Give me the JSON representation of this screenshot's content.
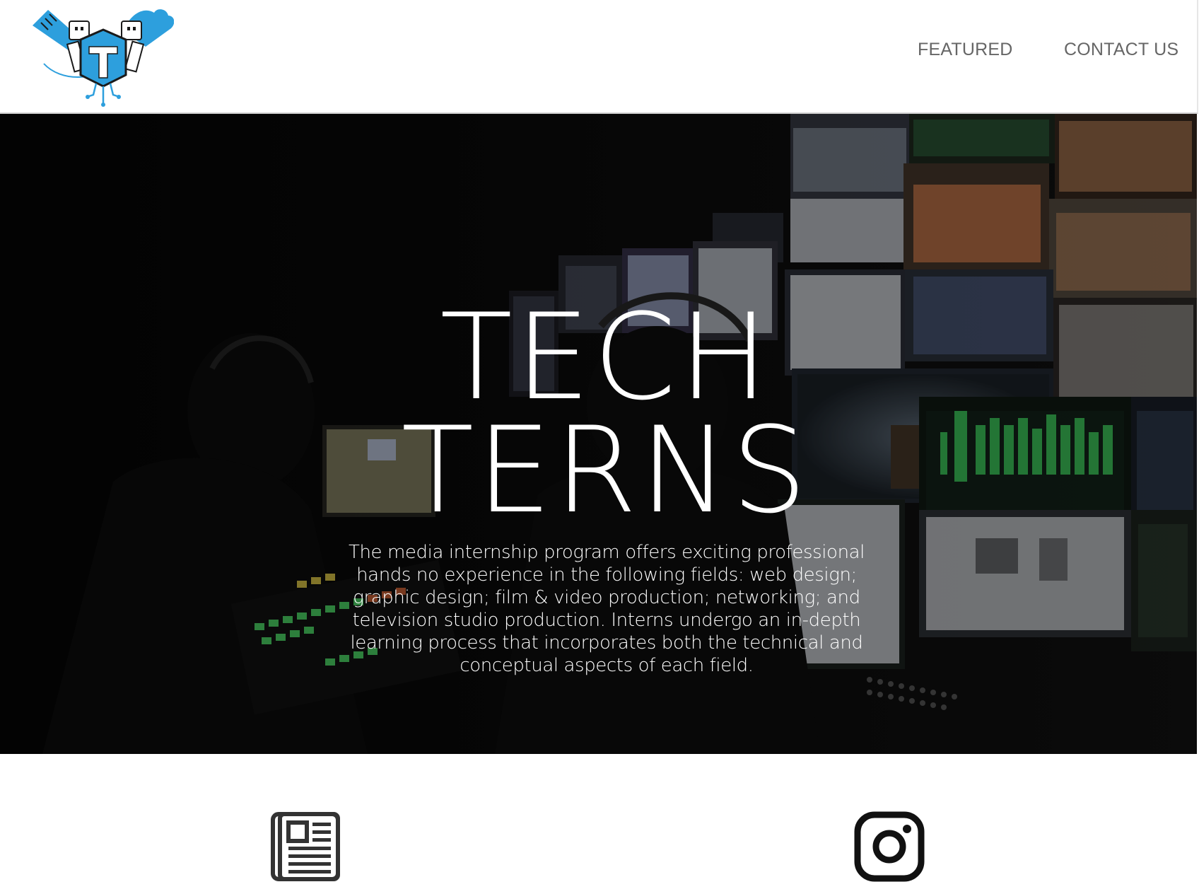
{
  "nav": {
    "featured_label": "FEATURED",
    "contact_label": "CONTACT US"
  },
  "hero": {
    "title_line1": "TECH",
    "title_line2": "TERNS",
    "description": "The media internship program offers exciting professional hands no experience in the following fields: web design; graphic design; film & video production; networking; and television studio production. Interns undergo an in-depth learning process that incorporates both the technical and conceptual aspects of each field."
  },
  "icons": {
    "left": "newspaper-icon",
    "right": "instagram-icon"
  },
  "colors": {
    "logo_blue": "#2d9fdd",
    "nav_text": "#666666",
    "hero_bg": "#050505",
    "hero_text": "#ffffff",
    "icon_dark": "#333333"
  }
}
